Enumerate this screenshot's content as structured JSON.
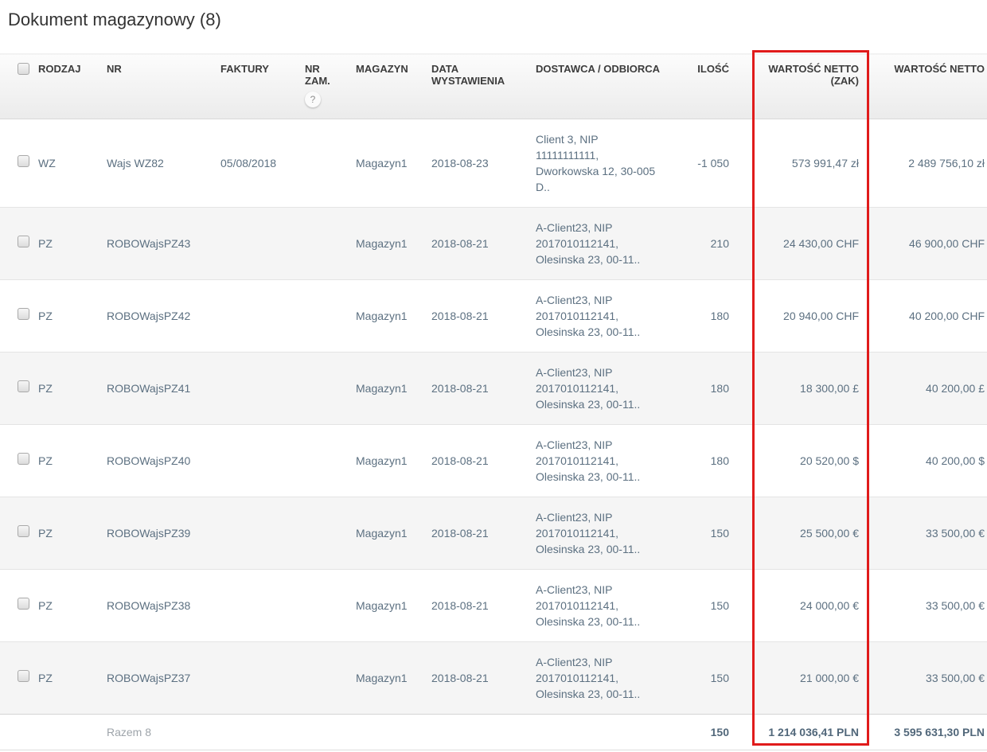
{
  "page": {
    "title": "Dokument magazynowy (8)"
  },
  "highlight": {
    "color": "#e01b1b",
    "target": "wartosc-netto-zak-column"
  },
  "table": {
    "headers": {
      "rodzaj": "RODZAJ",
      "nr": "NR",
      "faktury": "FAKTURY",
      "nr_zam": [
        "NR",
        "ZAM."
      ],
      "nr_zam_help": "?",
      "magazyn": "MAGAZYN",
      "data_wystawienia": [
        "DATA",
        "WYSTAWIENIA"
      ],
      "dostawca_odbiorca": "DOSTAWCA / ODBIORCA",
      "ilosc": "ILOŚĆ",
      "wartosc_netto_zak": [
        "WARTOŚĆ NETTO",
        "(ZAK)"
      ],
      "wartosc_netto": "WARTOŚĆ NETTO"
    },
    "rows": [
      {
        "rodzaj": "WZ",
        "nr": "Wajs WZ82",
        "faktury": "05/08/2018",
        "nr_zam": "",
        "magazyn": "Magazyn1",
        "data_wystawienia": "2018-08-23",
        "dostawca": [
          "Client 3, NIP",
          "11111111111,",
          "Dworkowska 12, 30-005",
          "D.."
        ],
        "ilosc": "-1 050",
        "netto_zak": "573 991,47 zł",
        "netto": "2 489 756,10 zł"
      },
      {
        "rodzaj": "PZ",
        "nr": "ROBOWajsPZ43",
        "faktury": "",
        "nr_zam": "",
        "magazyn": "Magazyn1",
        "data_wystawienia": "2018-08-21",
        "dostawca": [
          "A-Client23, NIP",
          "2017010112141,",
          "Olesinska 23, 00-11.."
        ],
        "ilosc": "210",
        "netto_zak": "24 430,00 CHF",
        "netto": "46 900,00 CHF"
      },
      {
        "rodzaj": "PZ",
        "nr": "ROBOWajsPZ42",
        "faktury": "",
        "nr_zam": "",
        "magazyn": "Magazyn1",
        "data_wystawienia": "2018-08-21",
        "dostawca": [
          "A-Client23, NIP",
          "2017010112141,",
          "Olesinska 23, 00-11.."
        ],
        "ilosc": "180",
        "netto_zak": "20 940,00 CHF",
        "netto": "40 200,00 CHF"
      },
      {
        "rodzaj": "PZ",
        "nr": "ROBOWajsPZ41",
        "faktury": "",
        "nr_zam": "",
        "magazyn": "Magazyn1",
        "data_wystawienia": "2018-08-21",
        "dostawca": [
          "A-Client23, NIP",
          "2017010112141,",
          "Olesinska 23, 00-11.."
        ],
        "ilosc": "180",
        "netto_zak": "18 300,00 £",
        "netto": "40 200,00 £"
      },
      {
        "rodzaj": "PZ",
        "nr": "ROBOWajsPZ40",
        "faktury": "",
        "nr_zam": "",
        "magazyn": "Magazyn1",
        "data_wystawienia": "2018-08-21",
        "dostawca": [
          "A-Client23, NIP",
          "2017010112141,",
          "Olesinska 23, 00-11.."
        ],
        "ilosc": "180",
        "netto_zak": "20 520,00 $",
        "netto": "40 200,00 $"
      },
      {
        "rodzaj": "PZ",
        "nr": "ROBOWajsPZ39",
        "faktury": "",
        "nr_zam": "",
        "magazyn": "Magazyn1",
        "data_wystawienia": "2018-08-21",
        "dostawca": [
          "A-Client23, NIP",
          "2017010112141,",
          "Olesinska 23, 00-11.."
        ],
        "ilosc": "150",
        "netto_zak": "25 500,00 €",
        "netto": "33 500,00 €"
      },
      {
        "rodzaj": "PZ",
        "nr": "ROBOWajsPZ38",
        "faktury": "",
        "nr_zam": "",
        "magazyn": "Magazyn1",
        "data_wystawienia": "2018-08-21",
        "dostawca": [
          "A-Client23, NIP",
          "2017010112141,",
          "Olesinska 23, 00-11.."
        ],
        "ilosc": "150",
        "netto_zak": "24 000,00 €",
        "netto": "33 500,00 €"
      },
      {
        "rodzaj": "PZ",
        "nr": "ROBOWajsPZ37",
        "faktury": "",
        "nr_zam": "",
        "magazyn": "Magazyn1",
        "data_wystawienia": "2018-08-21",
        "dostawca": [
          "A-Client23, NIP",
          "2017010112141,",
          "Olesinska 23, 00-11.."
        ],
        "ilosc": "150",
        "netto_zak": "21 000,00 €",
        "netto": "33 500,00 €"
      }
    ],
    "footer": {
      "label": "Razem 8",
      "ilosc": "150",
      "netto_zak": "1 214 036,41 PLN",
      "netto": "3 595 631,30 PLN"
    }
  }
}
